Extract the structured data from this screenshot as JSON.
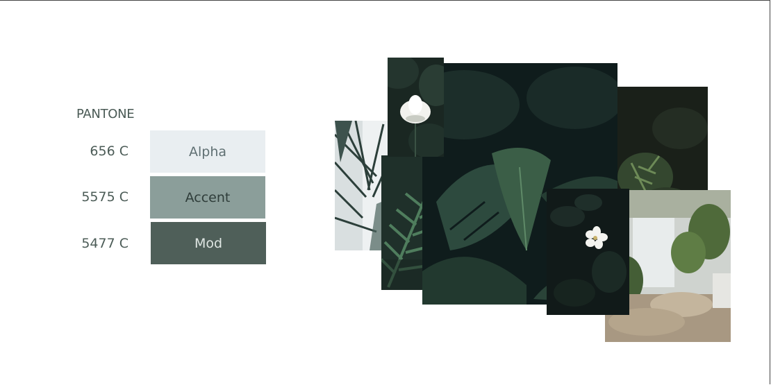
{
  "pantone": {
    "label": "PANTONE",
    "swatches": [
      {
        "code": "656 C",
        "name": "Alpha",
        "color": "#e9eef1",
        "text_color": "#5f6f72"
      },
      {
        "code": "5575 C",
        "name": "Accent",
        "color": "#8b9e9a",
        "text_color": "#2f3d3a"
      },
      {
        "code": "5477 C",
        "name": "Mod",
        "color": "#4f5f59",
        "text_color": "#dfe6e3"
      }
    ]
  },
  "moodboard": {
    "images": [
      {
        "name": "palm-leaves-image"
      },
      {
        "name": "fern-image"
      },
      {
        "name": "monstera-leaves-image"
      },
      {
        "name": "white-lotus-image"
      },
      {
        "name": "blurred-foliage-image"
      },
      {
        "name": "plant-bedroom-image"
      },
      {
        "name": "white-flower-image"
      }
    ]
  }
}
